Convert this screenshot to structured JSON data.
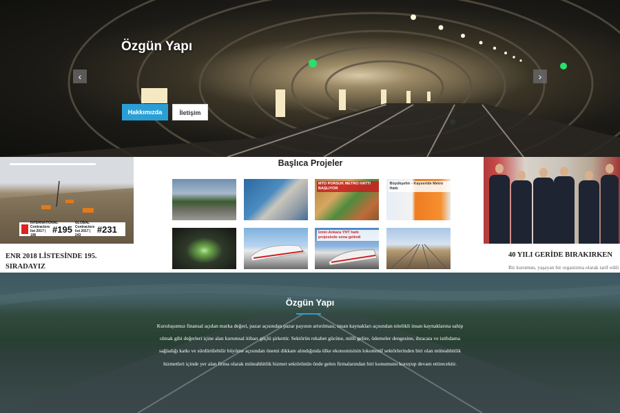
{
  "hero": {
    "title": "Özgün Yapı",
    "prev_glyph": "‹",
    "next_glyph": "›",
    "buttons": [
      {
        "label": "Hakkımızda",
        "color": "#2a9fd6"
      },
      {
        "label": "İletişim"
      }
    ]
  },
  "left_card": {
    "caption": "ENR 2018 LİSTESİNDE 195. SIRADAYIZ",
    "badge": {
      "intl_text": "INTERNATIONAL Contractors list 2017 | 196",
      "intl_rank": "#195",
      "global_text": "GLOBAL Contractors list 2017 | 243",
      "global_rank": "#231"
    }
  },
  "projects": {
    "title": "Başlıca Projeler",
    "thumbs": [
      {
        "label": ""
      },
      {
        "label": ""
      },
      {
        "label": "MTO PORSUK METRO HATTI BAŞLIYOR"
      },
      {
        "label": "Büyükşehir - Kayseride Metro Hattı"
      },
      {
        "label": ""
      },
      {
        "label": ""
      },
      {
        "label": "İzmir-Ankara YHT hattı projesinde sona gelindi"
      },
      {
        "label": ""
      }
    ]
  },
  "right_card": {
    "title": "40 YILI GERİDE BIRAKIRKEN",
    "text": "Bir kurumun, yaşayan bir organizma olarak tarif edilirken,"
  },
  "about": {
    "title": "Özgün Yapı",
    "text": "Kuruluşumuz finansal açıdan marka değeri, pazar açısından pazar payının artırılması, insan kaynakları açısından nitelikli insan kaynaklarına sahip olmak gibi değerleri içine alan kurumsal itibarı güçlü şirkettir. Sektörün rekabet gücüne, milli gelire, ödemeler dengesine, ihracata ve istihdama sağladığı katkı ve sürdürülebilir büyüme açısından önemi dikkate alındığında ülke ekonomisinin lokomotif sektörlerinden biri olan müteahhitlik hizmetleri içinde yer alan firma olarak müteahhitlik hizmet sektörünün önde gelen firmalarından biri konumunu koruyup devam ettirecektir.",
    "accent": "#2a9fd6"
  }
}
